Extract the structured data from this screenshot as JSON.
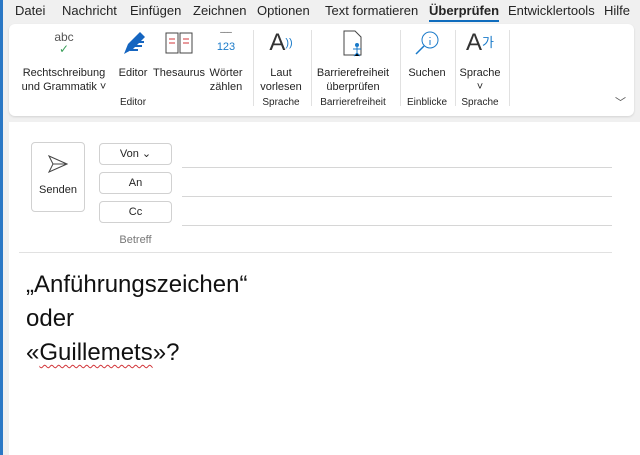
{
  "menu": [
    "Datei",
    "Nachricht",
    "Einfügen",
    "Zeichnen",
    "Optionen",
    "Text formatieren",
    "Überprüfen",
    "Entwicklertools",
    "Hilfe"
  ],
  "ribbon": {
    "spelling": {
      "icon_text": "abc",
      "l1": "Rechtschreibung",
      "l2": "und Grammatik ˅"
    },
    "editor": "Editor",
    "thesaurus": "Thesaurus",
    "words": {
      "l1": "Wörter",
      "l2": "zählen",
      "icon_text": "123"
    },
    "group_editor": "Editor",
    "read": {
      "l1": "Laut",
      "l2": "vorlesen"
    },
    "group_speech": "Sprache",
    "access": {
      "l1": "Barrierefreiheit",
      "l2": "überprüfen"
    },
    "group_access": "Barrierefreiheit",
    "search": "Suchen",
    "group_insights": "Einblicke",
    "language": {
      "l1": "Sprache",
      "l2": "˅"
    },
    "group_language": "Sprache"
  },
  "compose": {
    "send": "Senden",
    "from": "Von",
    "to": "An",
    "cc": "Cc",
    "subject": "Betreff"
  },
  "body": {
    "line1": "„Anführungszeichen“",
    "line2": "oder",
    "line3a": "«",
    "line3b": "Guillemets",
    "line3c": "»?"
  }
}
